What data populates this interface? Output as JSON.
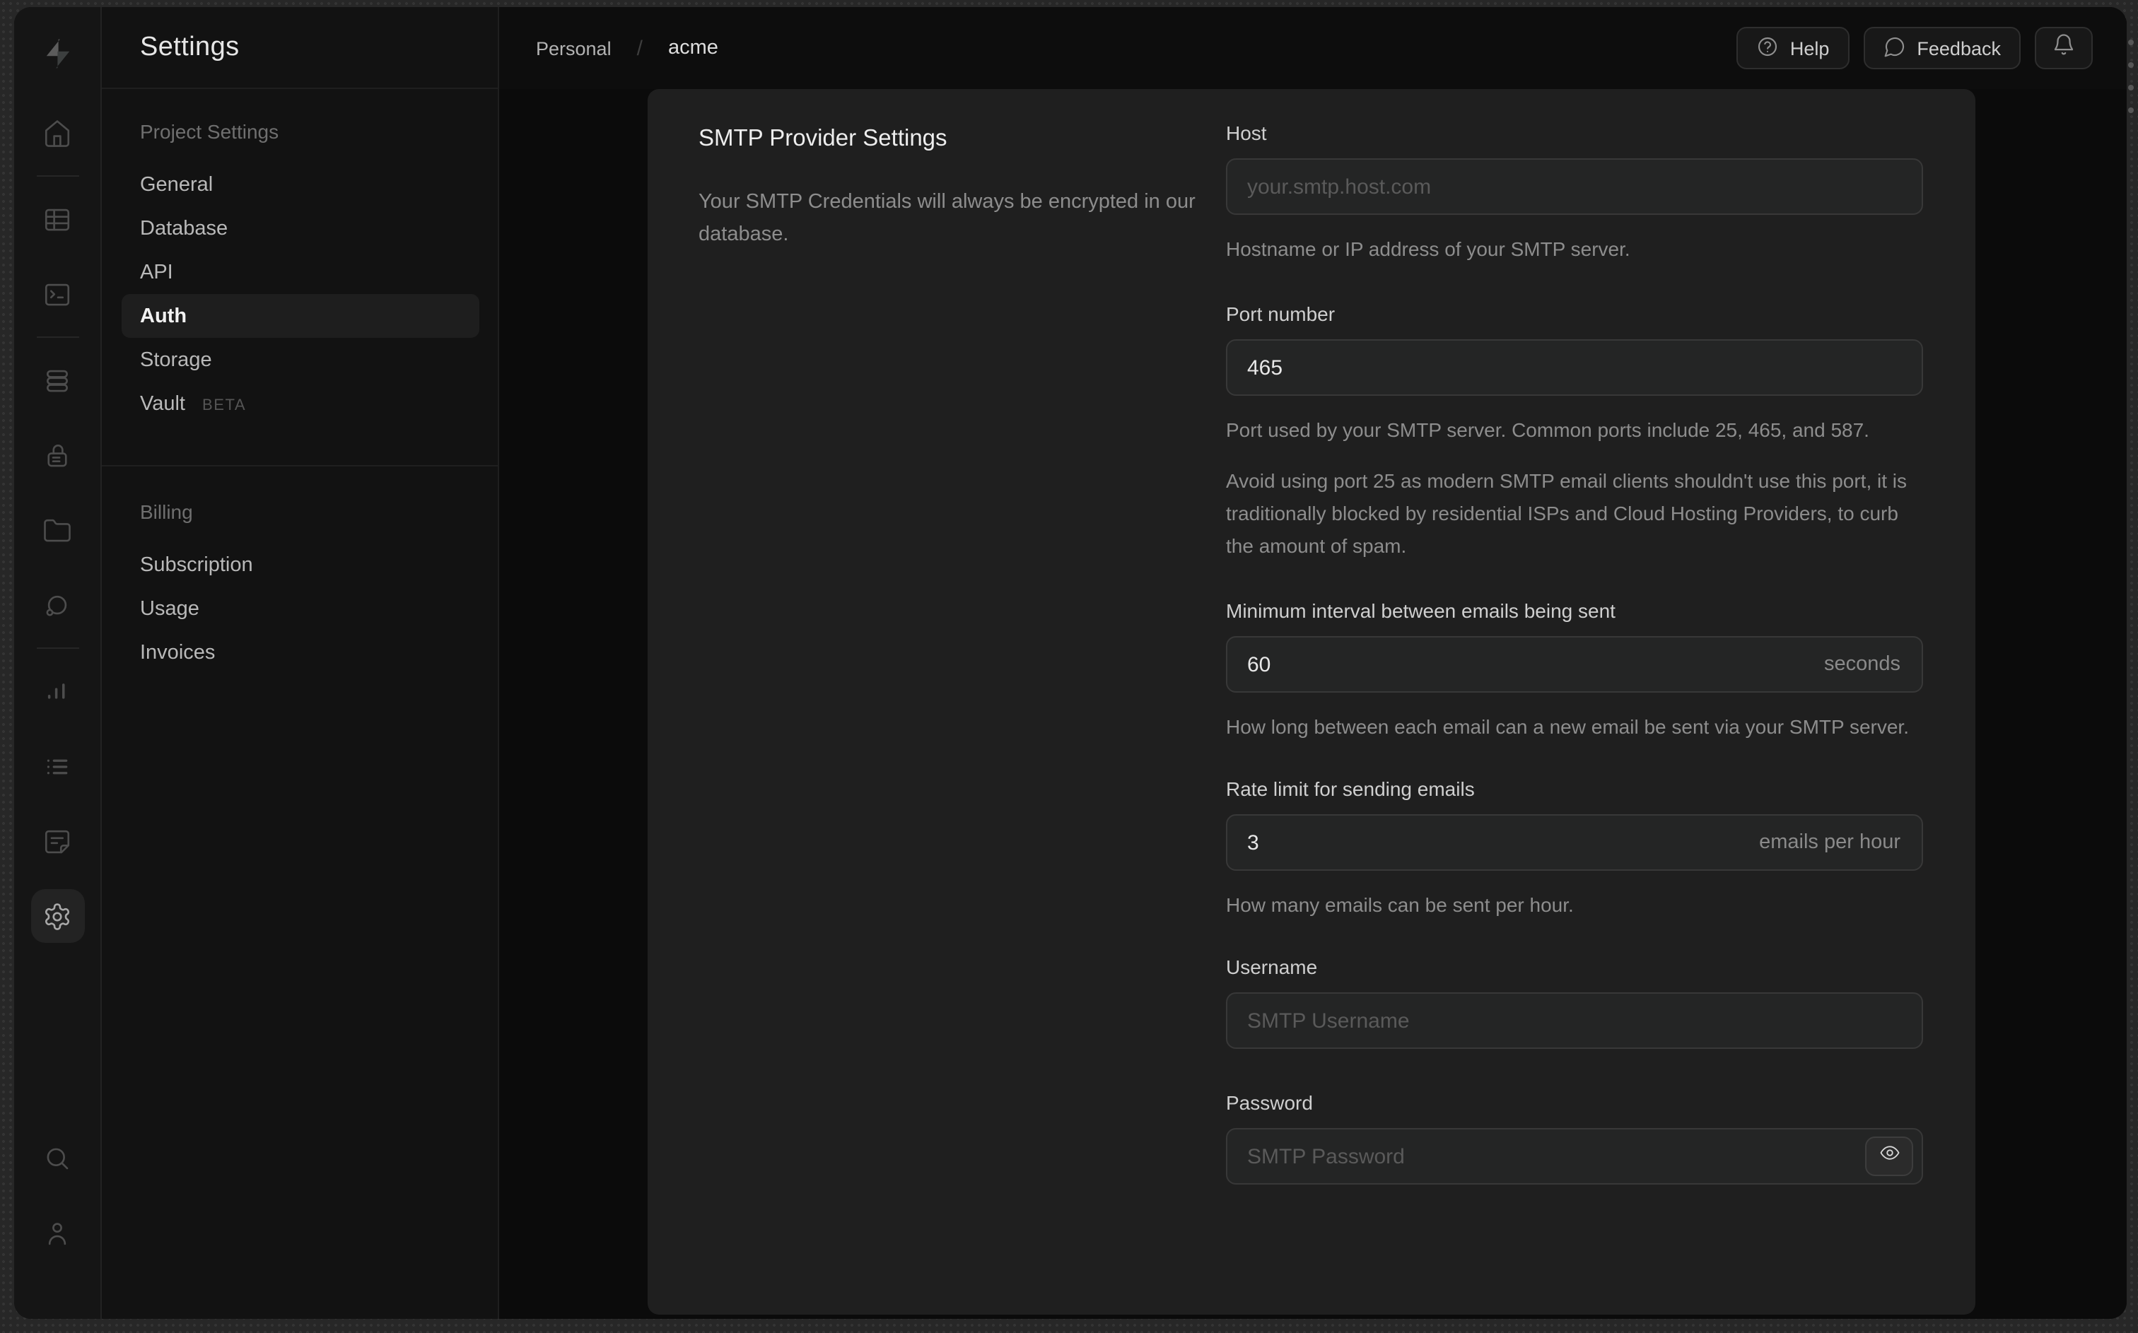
{
  "sidebar_rail": {
    "icons": [
      "supabase-logo",
      "home",
      "table-editor",
      "sql-editor",
      "database",
      "auth",
      "storage",
      "edge-functions",
      "reports",
      "logs",
      "api-docs",
      "settings",
      "search",
      "user"
    ],
    "active_icon": "settings"
  },
  "settings_menu": {
    "title": "Settings",
    "sections": [
      {
        "label": "Project Settings",
        "items": [
          {
            "label": "General"
          },
          {
            "label": "Database"
          },
          {
            "label": "API"
          },
          {
            "label": "Auth",
            "active": true
          },
          {
            "label": "Storage"
          },
          {
            "label": "Vault",
            "badge": "BETA"
          }
        ]
      },
      {
        "label": "Billing",
        "items": [
          {
            "label": "Subscription"
          },
          {
            "label": "Usage"
          },
          {
            "label": "Invoices"
          }
        ]
      }
    ]
  },
  "header": {
    "breadcrumb": [
      "Personal",
      "acme"
    ],
    "divider": "/",
    "help_label": "Help",
    "feedback_label": "Feedback"
  },
  "panel": {
    "title": "SMTP Provider Settings",
    "description": "Your SMTP Credentials will always be encrypted in our database.",
    "fields": {
      "host": {
        "label": "Host",
        "placeholder": "your.smtp.host.com",
        "helper": "Hostname or IP address of your SMTP server."
      },
      "port": {
        "label": "Port number",
        "value": "465",
        "helper": "Port used by your SMTP server. Common ports include 25, 465, and 587.",
        "note": "Avoid using port 25 as modern SMTP email clients shouldn't use this port, it is traditionally blocked by residential ISPs and Cloud Hosting Providers, to curb the amount of spam."
      },
      "interval": {
        "label": "Minimum interval between emails being sent",
        "value": "60",
        "suffix": "seconds",
        "helper": "How long between each email can a new email be sent via your SMTP server."
      },
      "rate": {
        "label": "Rate limit for sending emails",
        "value": "3",
        "suffix": "emails per hour",
        "helper": "How many emails can be sent per hour."
      },
      "username": {
        "label": "Username",
        "placeholder": "SMTP Username"
      },
      "password": {
        "label": "Password",
        "placeholder": "SMTP Password"
      }
    }
  },
  "colors": {
    "window_bg": "#0d0d0d",
    "card_bg": "#1f1f1f",
    "input_bg": "#242525",
    "input_border": "#383838",
    "text_primary": "#ededed",
    "text_muted": "#8d8d8d",
    "placeholder": "#5a5a5a"
  }
}
